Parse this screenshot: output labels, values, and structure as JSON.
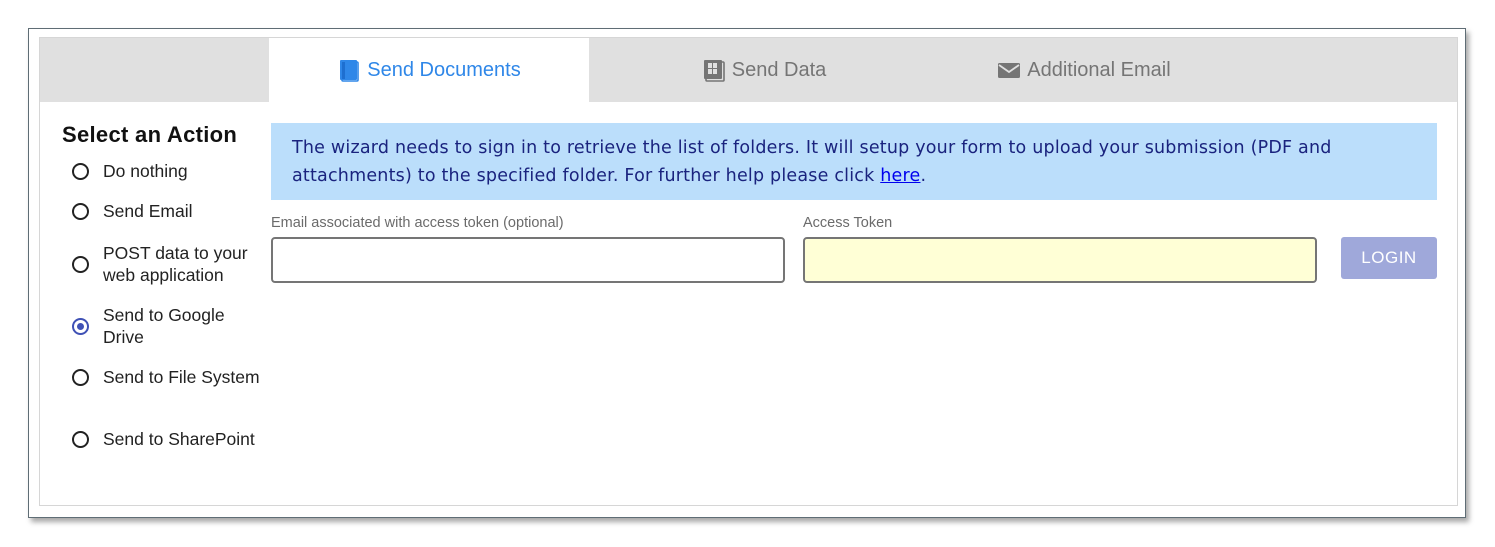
{
  "tabs": [
    {
      "label": "Send Documents",
      "icon": "document-icon",
      "active": true
    },
    {
      "label": "Send Data",
      "icon": "table-icon",
      "active": false
    },
    {
      "label": "Additional Email",
      "icon": "envelope-icon",
      "active": false
    }
  ],
  "sidebar": {
    "title": "Select an Action",
    "options": [
      {
        "label": "Do nothing",
        "checked": false
      },
      {
        "label": "Send Email",
        "checked": false
      },
      {
        "label": "POST data to your web application",
        "checked": false
      },
      {
        "label": "Send to Google Drive",
        "checked": true
      },
      {
        "label": "Send to File System",
        "checked": false
      },
      {
        "label": "Send to SharePoint",
        "checked": false
      }
    ]
  },
  "info": {
    "text": "The wizard needs to sign in to retrieve the list of folders. It will setup your form to upload your submission (PDF and attachments) to the specified folder. For further help please click ",
    "link": "here",
    "suffix": "."
  },
  "form": {
    "email_label": "Email associated with access token (optional)",
    "email_value": "",
    "token_label": "Access Token",
    "token_value": "",
    "login_label": "LOGIN"
  },
  "colors": {
    "accent": "#2f87e8",
    "info_bg": "#bbdefb",
    "info_text": "#1a237e",
    "token_bg": "#ffffd6",
    "login_bg": "#9fa8da",
    "radio_checked": "#3f51b5"
  }
}
